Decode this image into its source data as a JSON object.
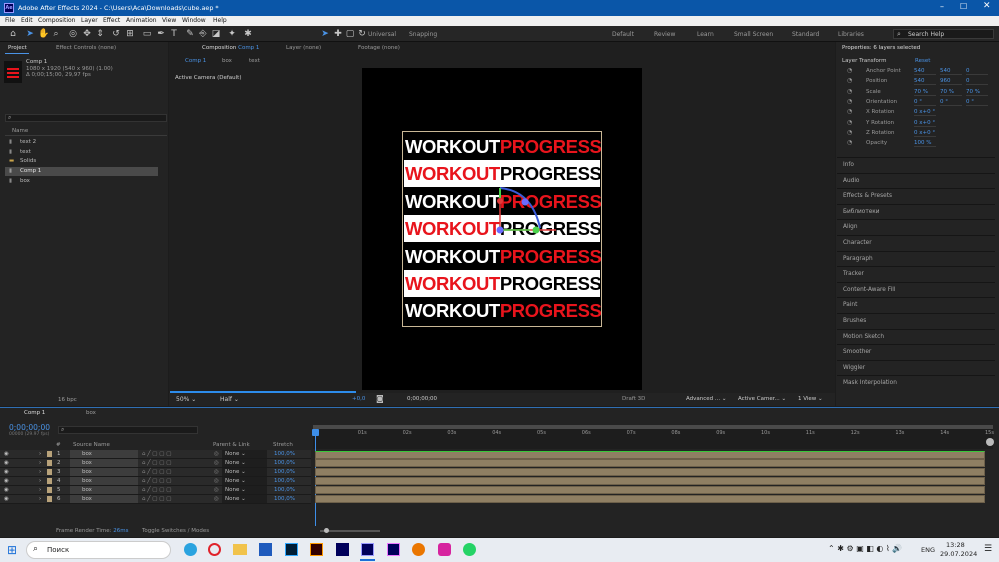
{
  "window": {
    "title": "Adobe After Effects 2024 - C:\\Users\\Aca\\Downloads\\cube.aep *",
    "app_icon": "Ae"
  },
  "menu": [
    "File",
    "Edit",
    "Composition",
    "Layer",
    "Effect",
    "Animation",
    "View",
    "Window",
    "Help"
  ],
  "toolbar": {
    "universal": "Universal",
    "snapping": "Snapping",
    "workspaces": [
      "Default",
      "Review",
      "Learn",
      "Small Screen",
      "Standard",
      "Libraries"
    ],
    "search_placeholder": "Search Help"
  },
  "project": {
    "tab": "Project",
    "effect_controls": "Effect Controls (none)",
    "item_name": "Comp 1",
    "item_info1": "1080 x 1920  (540 x 960) (1.00)",
    "item_info2": "Δ 0;00;15;00, 29,97 fps",
    "col_name": "Name",
    "items": [
      "text 2",
      "text",
      "Solids",
      "Comp 1",
      "box"
    ],
    "bpc": "16 bpc"
  },
  "composition": {
    "tab_prefix": "Composition",
    "tab_name": "Comp 1",
    "layer_tab": "Layer (none)",
    "footage_tab": "Footage (none)",
    "breadcrumbs": [
      "Comp 1",
      "box",
      "text"
    ],
    "camera_label": "Active Camera (Default)"
  },
  "artwork": {
    "left_word": "WORKOUT",
    "right_word": "PROGRESS",
    "red": "#e8141c",
    "rows": [
      {
        "bg": "black",
        "left": "white",
        "right": "red"
      },
      {
        "bg": "white",
        "left": "red",
        "right": "black"
      },
      {
        "bg": "black",
        "left": "white",
        "right": "red"
      },
      {
        "bg": "white",
        "left": "red",
        "right": "black"
      },
      {
        "bg": "black",
        "left": "white",
        "right": "red"
      },
      {
        "bg": "white",
        "left": "red",
        "right": "black"
      },
      {
        "bg": "black",
        "left": "white",
        "right": "red"
      }
    ]
  },
  "viewer_bar": {
    "zoom": "50%",
    "resolution": "Half",
    "exposure": "+0,0",
    "timecode": "0;00;00;00",
    "renderer": "Draft 3D",
    "renderer_mode": "Advanced ...",
    "camera": "Active Camer...",
    "views": "1 View"
  },
  "properties": {
    "title": "Properties: 6 layers selected",
    "section": "Layer Transform",
    "reset": "Reset",
    "rows": [
      {
        "label": "Anchor Point",
        "v": [
          "540",
          "540",
          "0"
        ]
      },
      {
        "label": "Position",
        "v": [
          "540",
          "960",
          "0"
        ]
      },
      {
        "label": "Scale",
        "v": [
          "70 %",
          "70 %",
          "70 %"
        ]
      },
      {
        "label": "Orientation",
        "v": [
          "0 °",
          "0 °",
          "0 °"
        ]
      },
      {
        "label": "X Rotation",
        "v": [
          "0 x+0 °"
        ]
      },
      {
        "label": "Y Rotation",
        "v": [
          "0 x+0 °"
        ]
      },
      {
        "label": "Z Rotation",
        "v": [
          "0 x+0 °"
        ]
      },
      {
        "label": "Opacity",
        "v": [
          "100 %"
        ]
      }
    ]
  },
  "side_panels": [
    "Info",
    "Audio",
    "Effects & Presets",
    "Библиотеки",
    "Align",
    "Character",
    "Paragraph",
    "Tracker",
    "Content-Aware Fill",
    "Paint",
    "Brushes",
    "Motion Sketch",
    "Smoother",
    "Wiggler",
    "Mask Interpolation"
  ],
  "timeline": {
    "tab": "Comp 1",
    "tab2": "box",
    "timecode": "0;00;00;00",
    "sub_timecode": "00000 (29.97 fps)",
    "col_num": "#",
    "col_source": "Source Name",
    "col_parent": "Parent & Link",
    "col_stretch": "Stretch",
    "ruler": [
      "0s",
      "01s",
      "02s",
      "03s",
      "04s",
      "05s",
      "06s",
      "07s",
      "08s",
      "09s",
      "10s",
      "11s",
      "12s",
      "13s",
      "14s",
      "15s"
    ],
    "layers": [
      {
        "n": "1",
        "name": "box",
        "parent": "None",
        "stretch": "100,0%"
      },
      {
        "n": "2",
        "name": "box",
        "parent": "None",
        "stretch": "100,0%"
      },
      {
        "n": "3",
        "name": "box",
        "parent": "None",
        "stretch": "100,0%"
      },
      {
        "n": "4",
        "name": "box",
        "parent": "None",
        "stretch": "100,0%"
      },
      {
        "n": "5",
        "name": "box",
        "parent": "None",
        "stretch": "100,0%"
      },
      {
        "n": "6",
        "name": "box",
        "parent": "None",
        "stretch": "100,0%"
      }
    ],
    "render_label": "Frame Render Time:",
    "render_value": "26ms",
    "toggle": "Toggle Switches / Modes"
  },
  "taskbar": {
    "search": "Поиск",
    "lang": "ENG",
    "time": "13:28",
    "date": "29.07.2024"
  }
}
